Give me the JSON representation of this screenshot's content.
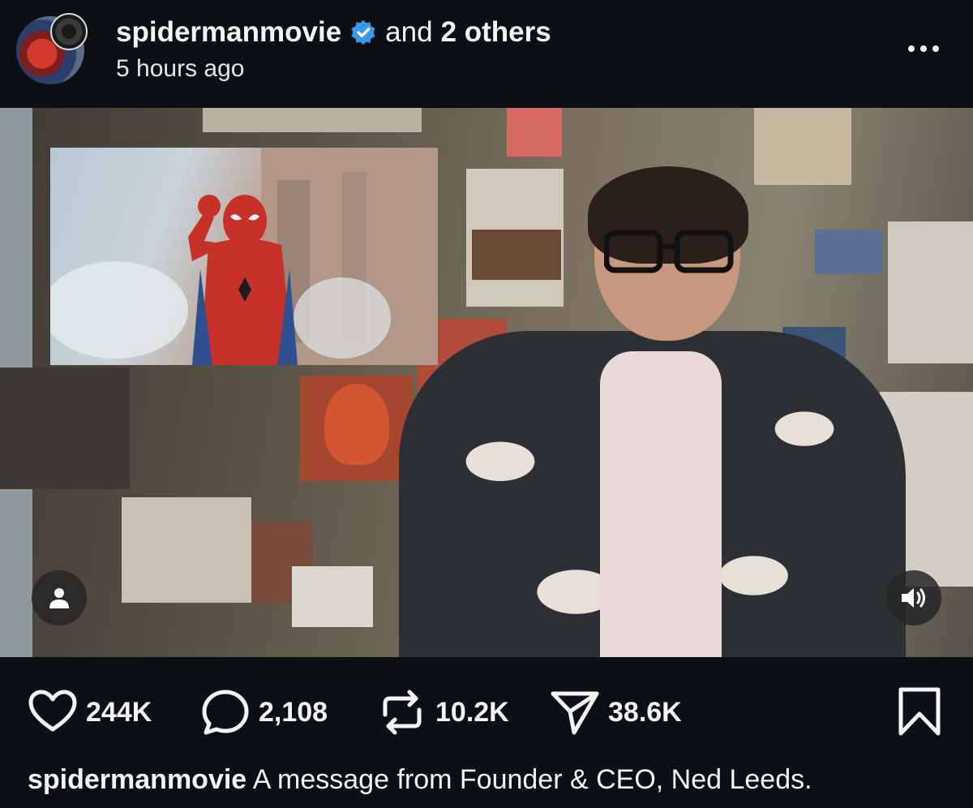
{
  "post": {
    "username": "spidermanmovie",
    "and_text": "and",
    "others_text": "2 others",
    "timestamp": "5 hours ago",
    "verified_color": "#3897f0"
  },
  "actions": {
    "likes": "244K",
    "comments": "2,108",
    "reposts": "10.2K",
    "shares": "38.6K"
  },
  "caption": {
    "username": "spidermanmovie",
    "text": "A message from Founder & CEO, Ned Leeds."
  },
  "icons": {
    "more": "more-horizontal-icon",
    "user": "user-icon",
    "sound": "volume-on-icon",
    "like": "heart-icon",
    "comment": "comment-bubble-icon",
    "repost": "repost-icon",
    "share": "send-icon",
    "save": "bookmark-icon"
  }
}
